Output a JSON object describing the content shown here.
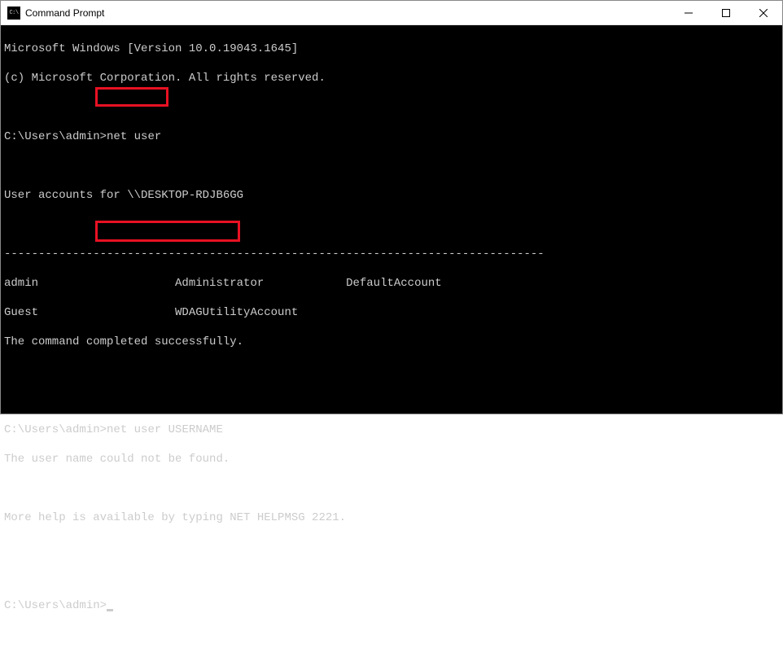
{
  "window": {
    "title": "Command Prompt"
  },
  "terminal": {
    "line1": "Microsoft Windows [Version 10.0.19043.1645]",
    "line2": "(c) Microsoft Corporation. All rights reserved.",
    "blank1": "",
    "prompt1_path": "C:\\Users\\admin>",
    "prompt1_cmd": "net user",
    "blank2": "",
    "accounts_header": "User accounts for \\\\DESKTOP-RDJB6GG",
    "blank3": "",
    "separator": "-------------------------------------------------------------------------------",
    "row1": "admin                    Administrator            DefaultAccount",
    "row2": "Guest                    WDAGUtilityAccount",
    "completed": "The command completed successfully.",
    "blank4": "",
    "blank5": "",
    "prompt2_path": "C:\\Users\\admin>",
    "prompt2_cmd": "net user USERNAME",
    "error": "The user name could not be found.",
    "blank6": "",
    "help": "More help is available by typing NET HELPMSG 2221.",
    "blank7": "",
    "blank8": "",
    "prompt3_path": "C:\\Users\\admin>"
  }
}
